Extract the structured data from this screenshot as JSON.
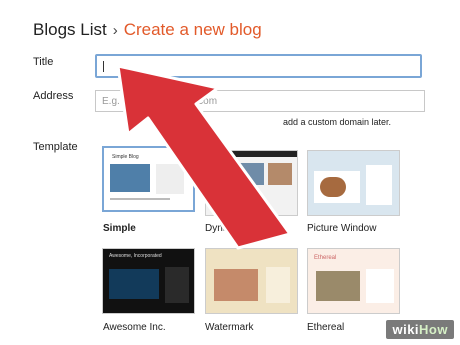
{
  "breadcrumb": {
    "parent": "Blogs List",
    "separator": "›",
    "current": "Create a new blog"
  },
  "form": {
    "title_label": "Title",
    "address_label": "Address",
    "address_placeholder": "E.g. myblog.blogspot.com",
    "address_hint": "add a custom domain later.",
    "template_label": "Template"
  },
  "templates": [
    {
      "name": "Simple",
      "selected": true
    },
    {
      "name": "Dynamic Views",
      "selected": false
    },
    {
      "name": "Picture Window",
      "selected": false
    },
    {
      "name": "Awesome Inc.",
      "selected": false
    },
    {
      "name": "Watermark",
      "selected": false
    },
    {
      "name": "Ethereal",
      "selected": false
    }
  ],
  "thumb_text": {
    "simple_title": "Simple Blog",
    "awesome_title": "Awesome, Incorporated",
    "ethereal_title": "Ethereal"
  },
  "watermark": {
    "prefix": "wiki",
    "suffix": "How"
  },
  "colors": {
    "accent": "#e25a2a",
    "arrow": "#d93238",
    "selected_border": "#7aa6d6"
  }
}
